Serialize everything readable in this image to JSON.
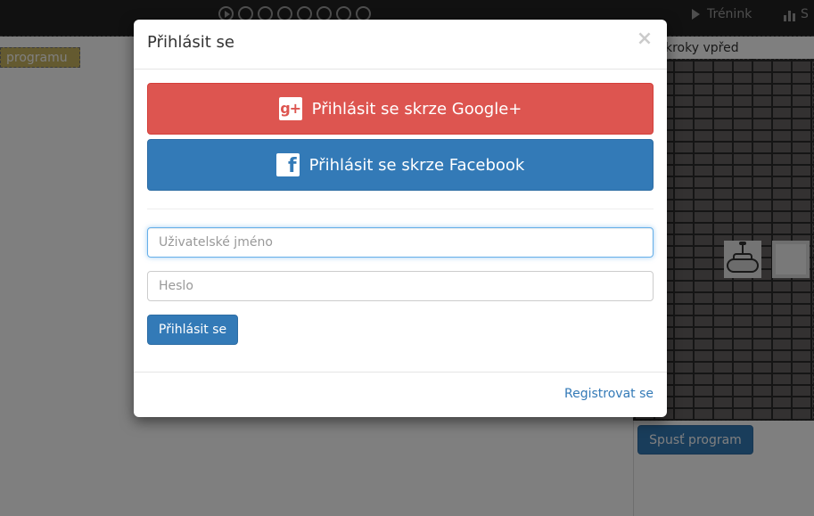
{
  "topbar": {
    "step_indicators": 8,
    "training_label": "Trénink",
    "stats_label": "S"
  },
  "workspace": {
    "program_label": "programu",
    "steps_forward_label": "kroky vpřed",
    "run_button_label": "Spusť program"
  },
  "login_modal": {
    "title": "Přihlásit se",
    "close_symbol": "×",
    "google_button_label": "Přihlásit se skrze Google+",
    "google_icon_text": "g+",
    "facebook_button_label": "Přihlásit se skrze Facebook",
    "facebook_icon_text": "f",
    "username_placeholder": "Uživatelské jméno",
    "username_value": "",
    "password_placeholder": "Heslo",
    "password_value": "",
    "submit_label": "Přihlásit se",
    "register_link": "Registrovat se"
  },
  "colors": {
    "google": "#dd5550",
    "facebook": "#337ab7",
    "primary": "#337ab7",
    "navbar": "#222222"
  }
}
